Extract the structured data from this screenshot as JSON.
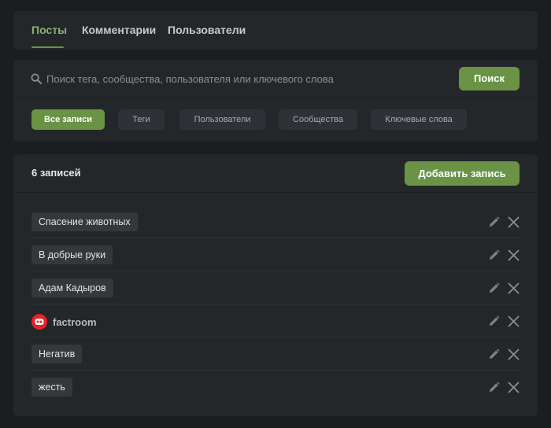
{
  "tabs": [
    {
      "label": "Посты",
      "active": true
    },
    {
      "label": "Комментарии",
      "active": false
    },
    {
      "label": "Пользователи",
      "active": false
    }
  ],
  "search": {
    "placeholder": "Поиск тега, сообщества, пользователя или ключевого слова",
    "value": "",
    "button_label": "Поиск",
    "icon": "search-icon"
  },
  "filters": [
    {
      "label": "Все записи",
      "active": true
    },
    {
      "label": "Теги",
      "active": false
    },
    {
      "label": "Пользователи",
      "active": false
    },
    {
      "label": "Сообщества",
      "active": false
    },
    {
      "label": "Ключевые слова",
      "active": false
    }
  ],
  "list": {
    "count_label": "6 записей",
    "add_button_label": "Добавить запись",
    "items": [
      {
        "type": "tag",
        "label": "Спасение животных"
      },
      {
        "type": "tag",
        "label": "В добрые руки"
      },
      {
        "type": "tag",
        "label": "Адам Кадыров"
      },
      {
        "type": "community",
        "label": "factroom"
      },
      {
        "type": "tag",
        "label": "Негатив"
      },
      {
        "type": "tag",
        "label": "жесть"
      }
    ],
    "row_actions": [
      "pencil-icon",
      "close-icon"
    ]
  },
  "colors": {
    "accent": "#6a9346",
    "accent_text": "#8ab26c",
    "background": "#1b1d20",
    "panel": "#24272a",
    "avatar": "#e8222b"
  }
}
